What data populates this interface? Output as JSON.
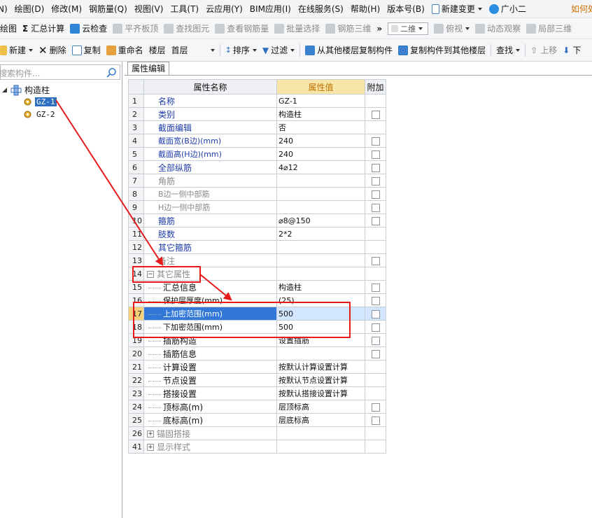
{
  "menubar": {
    "items": [
      "N)",
      "绘图(D)",
      "修改(M)",
      "钢筋量(Q)",
      "视图(V)",
      "工具(T)",
      "云应用(Y)",
      "BIM应用(I)",
      "在线服务(S)",
      "帮助(H)",
      "版本号(B)",
      "新建变更",
      "广小二"
    ],
    "right_label": "如何处"
  },
  "toolbar1": {
    "draw": "绘图",
    "sum": "汇总计算",
    "cloud_check": "云检查",
    "flat_slab": "平齐板顶",
    "find_element": "查找图元",
    "view_rebar": "查看钢筋量",
    "batch_select": "批量选择",
    "rebar_3d": "钢筋三维",
    "view_mode": "二维",
    "top_view": "俯视",
    "dynamic_view": "动态观察",
    "local_3d": "局部三维"
  },
  "toolbar2": {
    "new": "新建",
    "delete": "删除",
    "copy": "复制",
    "rename": "重命名",
    "floor_label": "楼层",
    "floor_value": "首层",
    "sort": "排序",
    "filter": "过滤",
    "copy_from_floor": "从其他楼层复制构件",
    "copy_to_floor": "复制构件到其他楼层",
    "find": "查找",
    "move_up": "上移",
    "move_down": "下"
  },
  "left": {
    "search_placeholder": "搜索构件...",
    "tree_root": "构造柱",
    "tree_items": [
      "GZ-1",
      "GZ-2"
    ]
  },
  "right": {
    "tab": "属性编辑",
    "columns": [
      "属性名称",
      "属性值",
      "附加"
    ],
    "rows": [
      {
        "num": "1",
        "name": "名称",
        "value": "GZ-1"
      },
      {
        "num": "2",
        "name": "类别",
        "value": "构造柱"
      },
      {
        "num": "3",
        "name": "截面编辑",
        "value": "否"
      },
      {
        "num": "4",
        "name": "截面宽(B边)(mm)",
        "value": "240"
      },
      {
        "num": "5",
        "name": "截面高(H边)(mm)",
        "value": "240"
      },
      {
        "num": "6",
        "name": "全部纵筋",
        "value": "4⌀12"
      },
      {
        "num": "7",
        "name": "角筋",
        "value": ""
      },
      {
        "num": "8",
        "name": "B边一侧中部筋",
        "value": ""
      },
      {
        "num": "9",
        "name": "H边一侧中部筋",
        "value": ""
      },
      {
        "num": "10",
        "name": "箍筋",
        "value": "⌀8@150"
      },
      {
        "num": "11",
        "name": "肢数",
        "value": "2*2"
      },
      {
        "num": "12",
        "name": "其它箍筋",
        "value": ""
      },
      {
        "num": "13",
        "name": "备注",
        "value": ""
      },
      {
        "num": "14",
        "name": "其它属性",
        "value": ""
      },
      {
        "num": "15",
        "name": "汇总信息",
        "value": "构造柱"
      },
      {
        "num": "16",
        "name": "保护层厚度(mm)",
        "value": "(25)"
      },
      {
        "num": "17",
        "name": "上加密范围(mm)",
        "value": "500"
      },
      {
        "num": "18",
        "name": "下加密范围(mm)",
        "value": "500"
      },
      {
        "num": "19",
        "name": "插筋构造",
        "value": "设置插筋"
      },
      {
        "num": "20",
        "name": "插筋信息",
        "value": ""
      },
      {
        "num": "21",
        "name": "计算设置",
        "value": "按默认计算设置计算"
      },
      {
        "num": "22",
        "name": "节点设置",
        "value": "按默认节点设置计算"
      },
      {
        "num": "23",
        "name": "搭接设置",
        "value": "按默认搭接设置计算"
      },
      {
        "num": "24",
        "name": "顶标高(m)",
        "value": "层顶标高"
      },
      {
        "num": "25",
        "name": "底标高(m)",
        "value": "层底标高"
      },
      {
        "num": "26",
        "name": "锚固搭接",
        "value": ""
      },
      {
        "num": "41",
        "name": "显示样式",
        "value": ""
      }
    ]
  },
  "colors": {
    "annotation": "#e8191a",
    "selection": "#3178d8",
    "header_highlight": "#f8e6a9"
  }
}
